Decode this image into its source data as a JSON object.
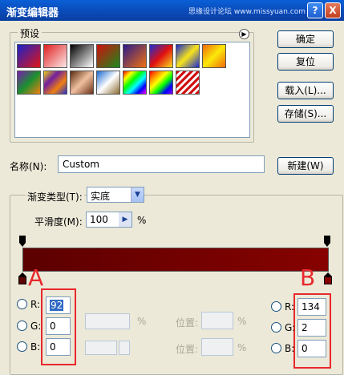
{
  "title": "渐变编辑器",
  "watermark": "思缘设计论坛 www.missyuan.com",
  "window_buttons": {
    "help": "?",
    "close": "X"
  },
  "presets": {
    "label": "预设",
    "swatches": [
      {
        "name": "fg-to-bg",
        "gradient": "linear-gradient(135deg,#1a22c8,#e11515)"
      },
      {
        "name": "fg-to-transparent",
        "gradient": "linear-gradient(135deg,#e02020,rgba(224,32,32,0.1))"
      },
      {
        "name": "black-white",
        "gradient": "linear-gradient(135deg,#000,#fff)"
      },
      {
        "name": "red-green",
        "gradient": "linear-gradient(135deg,#d01010,#1a8a1a)"
      },
      {
        "name": "violet-orange",
        "gradient": "linear-gradient(135deg,#2a1a8a,#f07010)"
      },
      {
        "name": "blue-red-yellow",
        "gradient": "linear-gradient(135deg,#1c2fd0,#e01010,#f8e020)"
      },
      {
        "name": "blue-yellow-blue",
        "gradient": "linear-gradient(135deg,#1a2ad0,#f8e41a,#1a2ad0)"
      },
      {
        "name": "orange-yellow-orange",
        "gradient": "linear-gradient(135deg,#f06a0a,#fbe80a,#f06a0a)"
      },
      {
        "name": "violet-green-orange",
        "gradient": "linear-gradient(135deg,#7a1ab0,#1a9030,#f08010)"
      },
      {
        "name": "yellow-violet-orange-blue",
        "gradient": "linear-gradient(135deg,#f0d010,#7020a0,#f08010,#2030d0)"
      },
      {
        "name": "copper",
        "gradient": "linear-gradient(135deg,#5a2a10,#f0c0a0,#6a3018)"
      },
      {
        "name": "chrome",
        "gradient": "linear-gradient(135deg,#1a6ad0,#fff,#8a6a30)"
      },
      {
        "name": "spectrum",
        "gradient": "linear-gradient(135deg,#f00,#ff0,#0f0,#0ff,#00f,#f0f)"
      },
      {
        "name": "transparent-rainbow",
        "gradient": "linear-gradient(135deg,#f00,#f80,#ff0,#0f0,#00f,#80f)"
      },
      {
        "name": "transparent-stripes",
        "gradient": "repeating-linear-gradient(135deg,#d01010 0 3px,#fff 3px 6px)"
      }
    ]
  },
  "buttons": {
    "ok": "确定",
    "reset": "复位",
    "load": "载入(L)...",
    "save": "存储(S)...",
    "new": "新建(W)"
  },
  "name": {
    "label": "名称(N):",
    "value": "Custom"
  },
  "gradient_type": {
    "label": "渐变类型(T):",
    "value": "实底"
  },
  "smoothness": {
    "label": "平滑度(M):",
    "value": "100",
    "unit": "%"
  },
  "gradient": {
    "start_color": "#5c0000",
    "end_color": "#860200"
  },
  "markers": {
    "a": "A",
    "b": "B"
  },
  "left_color": {
    "r_label": "R:",
    "r": "92",
    "g_label": "G:",
    "g": "0",
    "b_label": "B:",
    "b": "0"
  },
  "right_color": {
    "r_label": "R:",
    "r": "134",
    "g_label": "G:",
    "g": "2",
    "b_label": "B:",
    "b": "0"
  },
  "disabled": {
    "percent": "%",
    "location": "位置:"
  },
  "accent_color": "#e8282c"
}
